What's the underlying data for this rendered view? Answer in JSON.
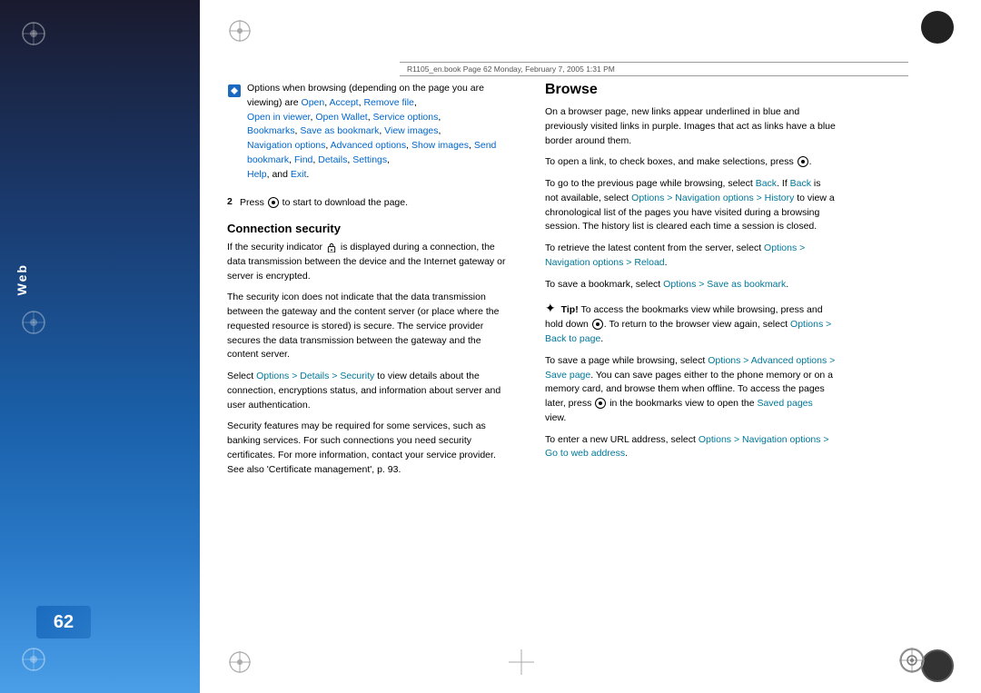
{
  "page": {
    "number": "62",
    "header_text": "R1105_en.book  Page 62  Monday, February 7, 2005  1:31 PM"
  },
  "sidebar": {
    "web_label": "Web"
  },
  "left_column": {
    "intro_paragraph": "Options when browsing (depending on the page you are viewing) are",
    "intro_links": [
      {
        "text": "Open",
        "color": "blue"
      },
      {
        "text": "Accept",
        "color": "blue"
      },
      {
        "text": "Remove file",
        "color": "blue"
      },
      {
        "text": "Open in viewer",
        "color": "blue"
      },
      {
        "text": "Open Wallet",
        "color": "blue"
      },
      {
        "text": "Service options",
        "color": "blue"
      },
      {
        "text": "Bookmarks",
        "color": "blue"
      },
      {
        "text": "Save as bookmark",
        "color": "blue"
      },
      {
        "text": "View images",
        "color": "blue"
      },
      {
        "text": "Navigation options",
        "color": "blue"
      },
      {
        "text": "Advanced options",
        "color": "blue"
      },
      {
        "text": "Show images",
        "color": "blue"
      },
      {
        "text": "Send bookmark",
        "color": "blue"
      },
      {
        "text": "Find",
        "color": "blue"
      },
      {
        "text": "Details",
        "color": "blue"
      },
      {
        "text": "Settings",
        "color": "blue"
      },
      {
        "text": "Help",
        "color": "blue"
      },
      {
        "text": "Exit",
        "color": "blue"
      }
    ],
    "step2_text": "Press",
    "step2_suffix": "to start to download the page.",
    "connection_security_title": "Connection security",
    "cs_para1": "If the security indicator",
    "cs_para1_suffix": "is displayed during a connection, the data transmission between the device and the Internet gateway or server is encrypted.",
    "cs_para2": "The security icon does not indicate that the data transmission between the gateway and the content server (or place where the requested resource is stored) is secure. The service provider secures the data transmission between the gateway and the content server.",
    "cs_para3_prefix": "Select",
    "cs_para3_link": "Options > Details > Security",
    "cs_para3_suffix": "to view details about the connection, encryptions status, and information about server and user authentication.",
    "cs_para4": "Security features may be required for some services, such as banking services. For such connections you need security certificates. For more information, contact your service provider. See also 'Certificate management', p. 93."
  },
  "right_column": {
    "browse_title": "Browse",
    "browse_para1": "On a browser page, new links appear underlined in blue and previously visited links in purple. Images that act as links have a blue border around them.",
    "browse_para2_prefix": "To open a link, to check boxes, and make selections, press",
    "browse_para2_suffix": ".",
    "browse_para3_prefix": "To go to the previous page while browsing, select",
    "browse_para3_link1": "Back",
    "browse_para3_mid": ". If",
    "browse_para3_link2": "Back",
    "browse_para3_mid2": "is not available, select",
    "browse_para3_link3": "Options > Navigation options > History",
    "browse_para3_suffix": "to view a chronological list of the pages you have visited during a browsing session. The history list is cleared each time a session is closed.",
    "browse_para4_prefix": "To retrieve the latest content from the server, select",
    "browse_para4_link": "Options > Navigation options > Reload",
    "browse_para4_suffix": ".",
    "browse_para5_prefix": "To save a bookmark, select",
    "browse_para5_link": "Options > Save as bookmark",
    "browse_para5_suffix": ".",
    "tip_icon": "✦",
    "tip_label": "Tip!",
    "tip_text": "To access the bookmarks view while browsing, press and hold down",
    "tip_text2": ". To return to the browser view again, select",
    "tip_link": "Options > Back to page",
    "tip_text3": ".",
    "browse_para6_prefix": "To save a page while browsing, select",
    "browse_para6_link": "Options > Advanced options > Save page",
    "browse_para6_mid": ". You can save pages either to the phone memory or on a memory card, and browse them when offline. To access the pages later, press",
    "browse_para6_link2": "",
    "browse_para6_suffix": "in the bookmarks view to open the",
    "browse_para6_link3": "Saved pages",
    "browse_para6_suffix2": "view.",
    "browse_para7_prefix": "To enter a new URL address, select",
    "browse_para7_link": "Options > Navigation options > Go to web address",
    "browse_para7_suffix": "."
  },
  "colors": {
    "link_blue": "#0066cc",
    "link_teal": "#007799",
    "sidebar_gradient_top": "#1a1a2e",
    "sidebar_gradient_bottom": "#4a9fe8",
    "page_number_bg": "#1a6abf"
  }
}
